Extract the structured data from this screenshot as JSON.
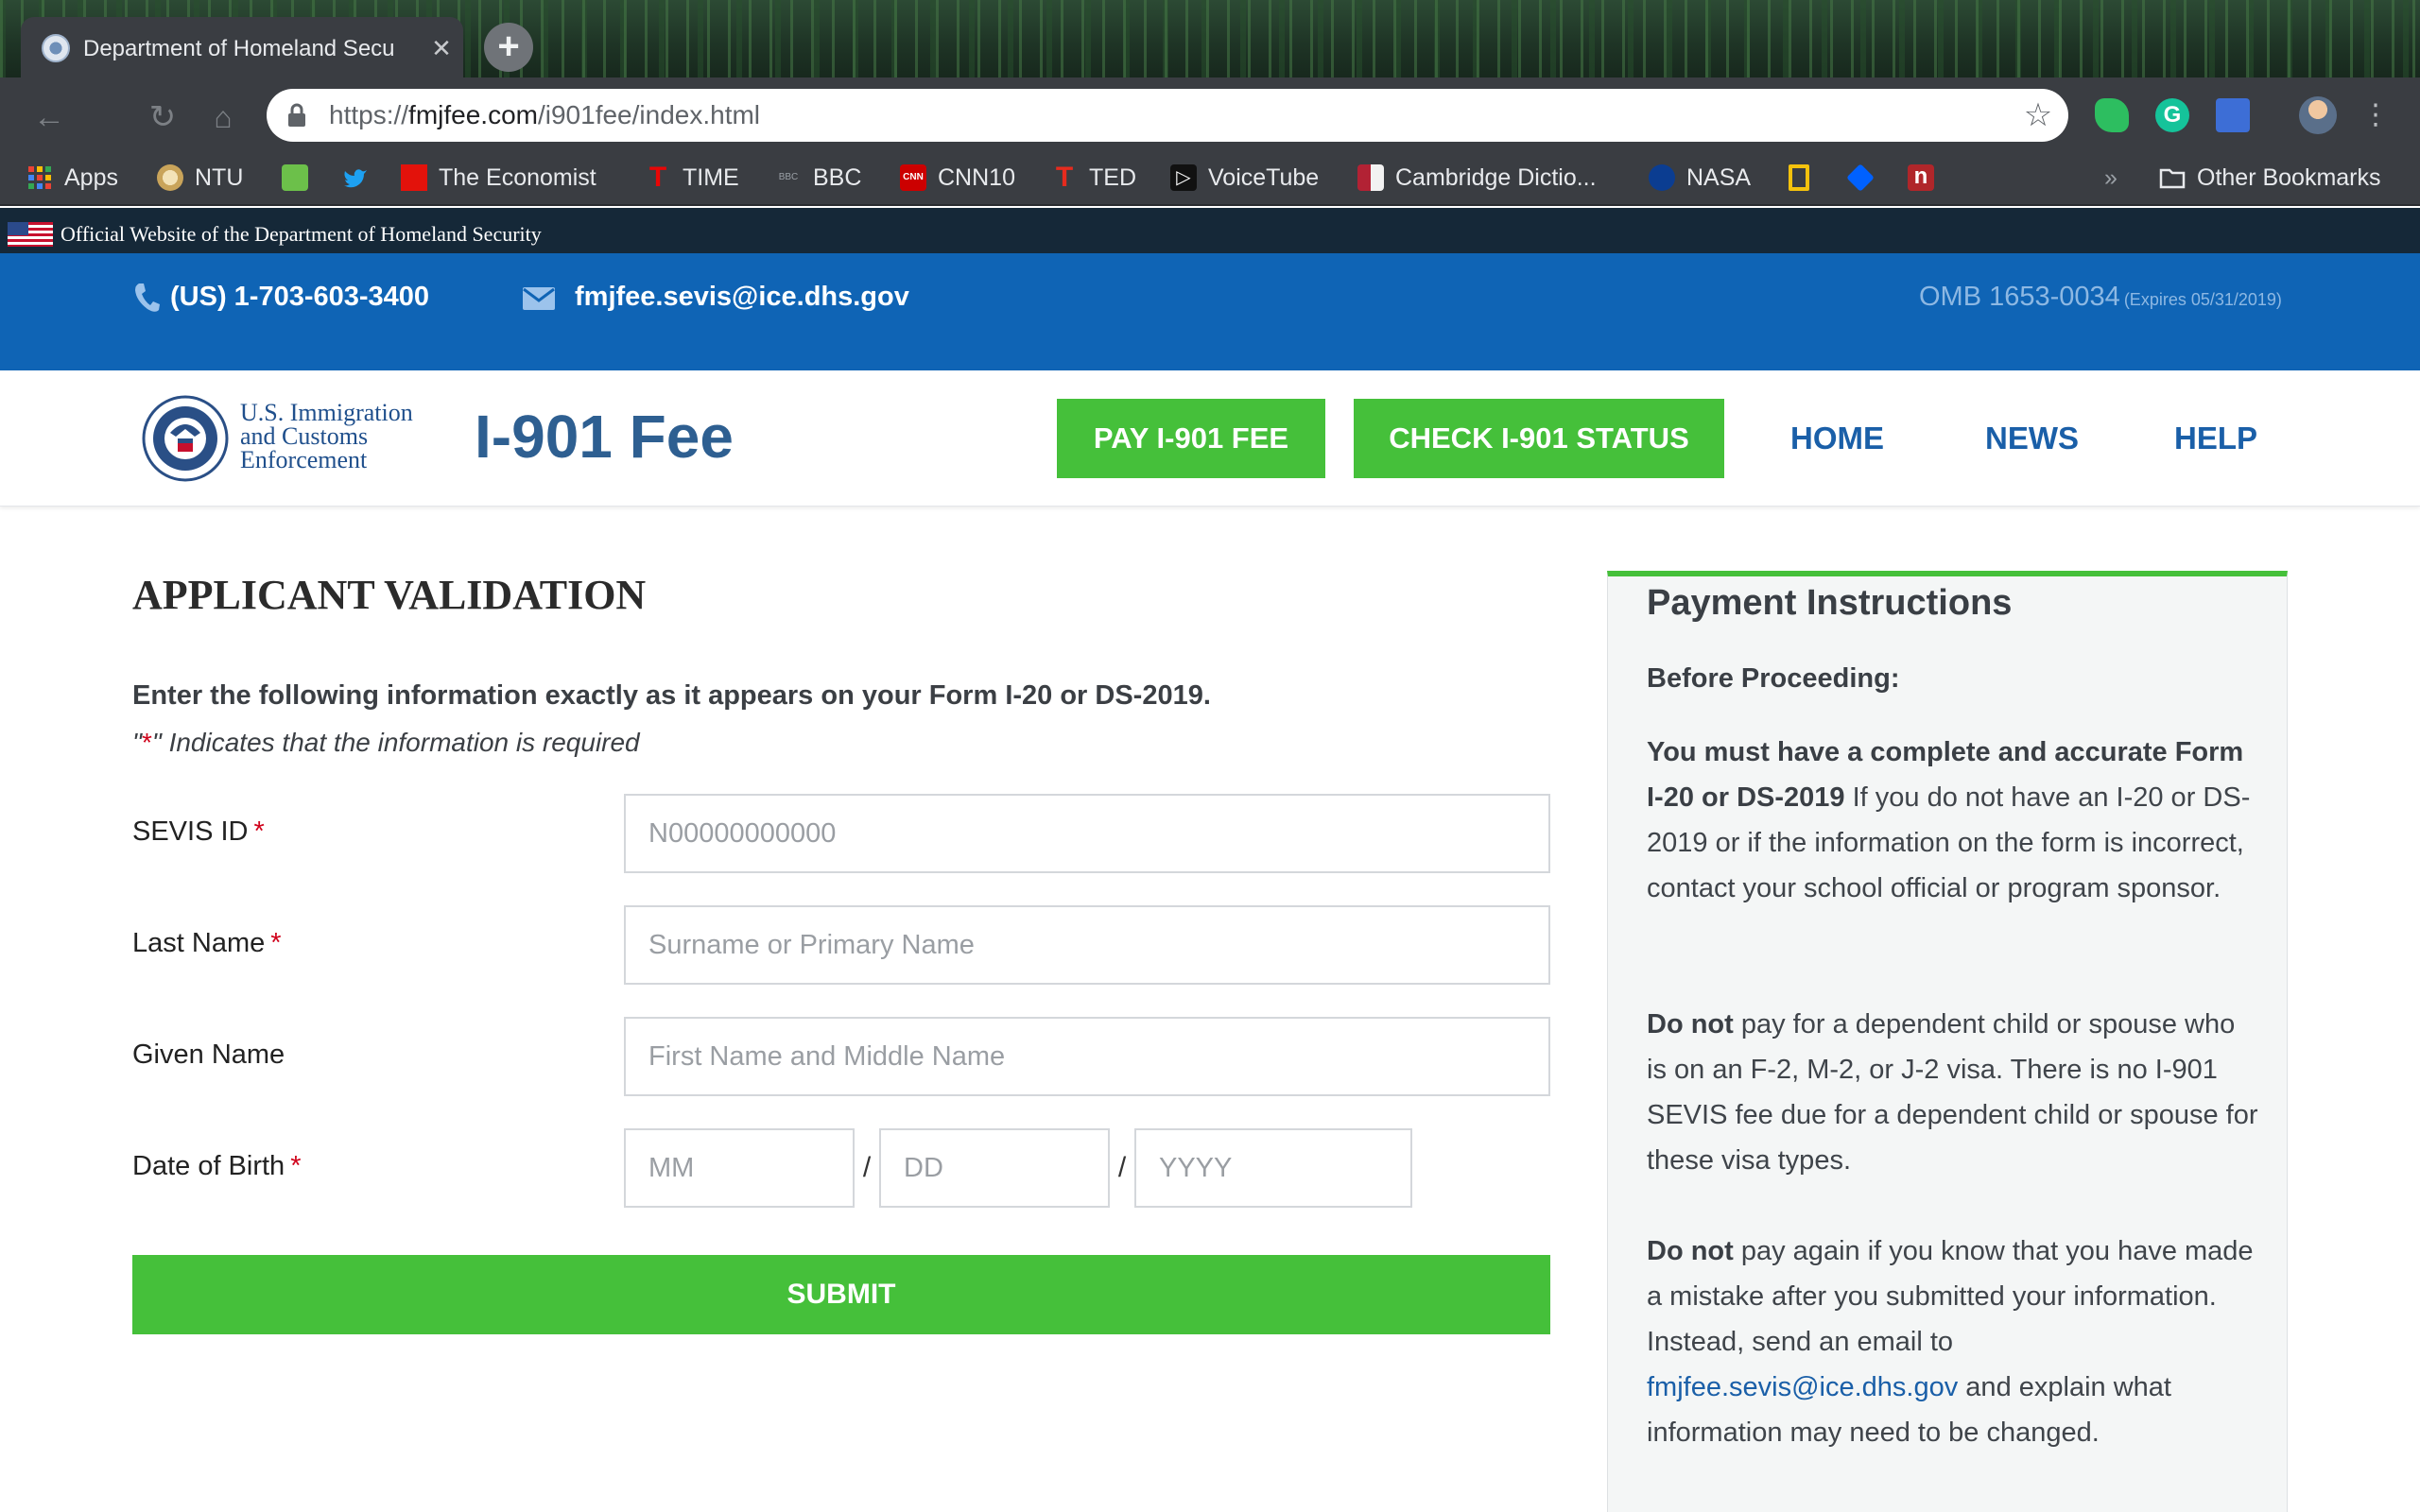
{
  "browser": {
    "tab_title": "Department of Homeland Secu",
    "url_scheme": "https://",
    "url_domain": "fmjfee.com",
    "url_path": "/i901fee/index.html",
    "bookmarks": [
      {
        "label": "Apps",
        "icon": "apps-grid-icon",
        "color": "#ea4335"
      },
      {
        "label": "NTU",
        "icon": "ntu-icon",
        "color": "#c9a45a"
      },
      {
        "label": "",
        "icon": "green-c-icon",
        "color": "#6cc04a"
      },
      {
        "label": "",
        "icon": "twitter-icon",
        "color": "#1da1f2"
      },
      {
        "label": "The Economist",
        "icon": "economist-icon",
        "color": "#e3120b"
      },
      {
        "label": "TIME",
        "icon": "time-icon",
        "color": "#e90606"
      },
      {
        "label": "BBC",
        "icon": "bbc-icon",
        "color": "#9aa0a6"
      },
      {
        "label": "CNN10",
        "icon": "cnn-icon",
        "color": "#cc0000"
      },
      {
        "label": "TED",
        "icon": "ted-icon",
        "color": "#e62b1e"
      },
      {
        "label": "VoiceTube",
        "icon": "voicetube-icon",
        "color": "#111111"
      },
      {
        "label": "Cambridge Dictio...",
        "icon": "cambridge-icon",
        "color": "#b22234"
      },
      {
        "label": "NASA",
        "icon": "nasa-icon",
        "color": "#0b3d91"
      },
      {
        "label": "",
        "icon": "yellow-note-icon",
        "color": "#f4c20d"
      },
      {
        "label": "",
        "icon": "dropbox-icon",
        "color": "#0061ff"
      },
      {
        "label": "",
        "icon": "n-icon",
        "color": "#b0262a"
      }
    ],
    "other_bookmarks": "Other Bookmarks"
  },
  "gov_banner": "Official Website of the Department of Homeland Security",
  "contact": {
    "phone": "(US) 1-703-603-3400",
    "email": "fmjfee.sevis@ice.dhs.gov",
    "omb": "OMB 1653-0034",
    "omb_expires": "(Expires 05/31/2019)"
  },
  "header": {
    "ice_logo_text": "U.S. Immigration and Customs Enforcement",
    "site_title": "I-901 Fee",
    "pay_button": "PAY I-901 FEE",
    "check_button": "CHECK I-901 STATUS",
    "nav": {
      "home": "HOME",
      "news": "NEWS",
      "help": "HELP"
    }
  },
  "form": {
    "title": "APPLICANT VALIDATION",
    "instruction": "Enter the following information exactly as it appears on your Form I-20 or DS-2019.",
    "required_note_prefix": "\"",
    "required_note_star": "*",
    "required_note_suffix": "\" Indicates that the information is required",
    "sevis_label": "SEVIS ID",
    "sevis_placeholder": "N00000000000",
    "lastname_label": "Last Name",
    "lastname_placeholder": "Surname or Primary Name",
    "givenname_label": "Given Name",
    "givenname_placeholder": "First Name and Middle Name",
    "dob_label": "Date of Birth",
    "dob_mm_placeholder": "MM",
    "dob_dd_placeholder": "DD",
    "dob_yyyy_placeholder": "YYYY",
    "date_separator": "/",
    "required_star": "*",
    "submit": "SUBMIT"
  },
  "sidebar": {
    "title": "Payment Instructions",
    "before": "Before Proceeding:",
    "p1_bold": "You must have a complete and accurate Form I-20 or DS-2019",
    "p1_text": " If you do not have an I-20 or DS-2019 or if the information on the form is incorrect, contact your school official or program sponsor.",
    "p2_bold": "Do not",
    "p2_text": " pay for a dependent child or spouse who is on an F-2, M-2, or J-2 visa. There is no I-901 SEVIS fee due for a dependent child or spouse for these visa types.",
    "p3_bold": "Do not",
    "p3_text_a": " pay again if you know that you have made a mistake after you submitted your information. Instead, send an email to ",
    "p3_link": "fmjfee.sevis@ice.dhs.gov",
    "p3_text_b": " and explain what information may need to be changed."
  },
  "colors": {
    "contact_bar": "#0f64b5",
    "green_button": "#45c03a",
    "nav_link": "#1a5fa8",
    "gov_banner": "#152838",
    "required": "#d0021b"
  }
}
